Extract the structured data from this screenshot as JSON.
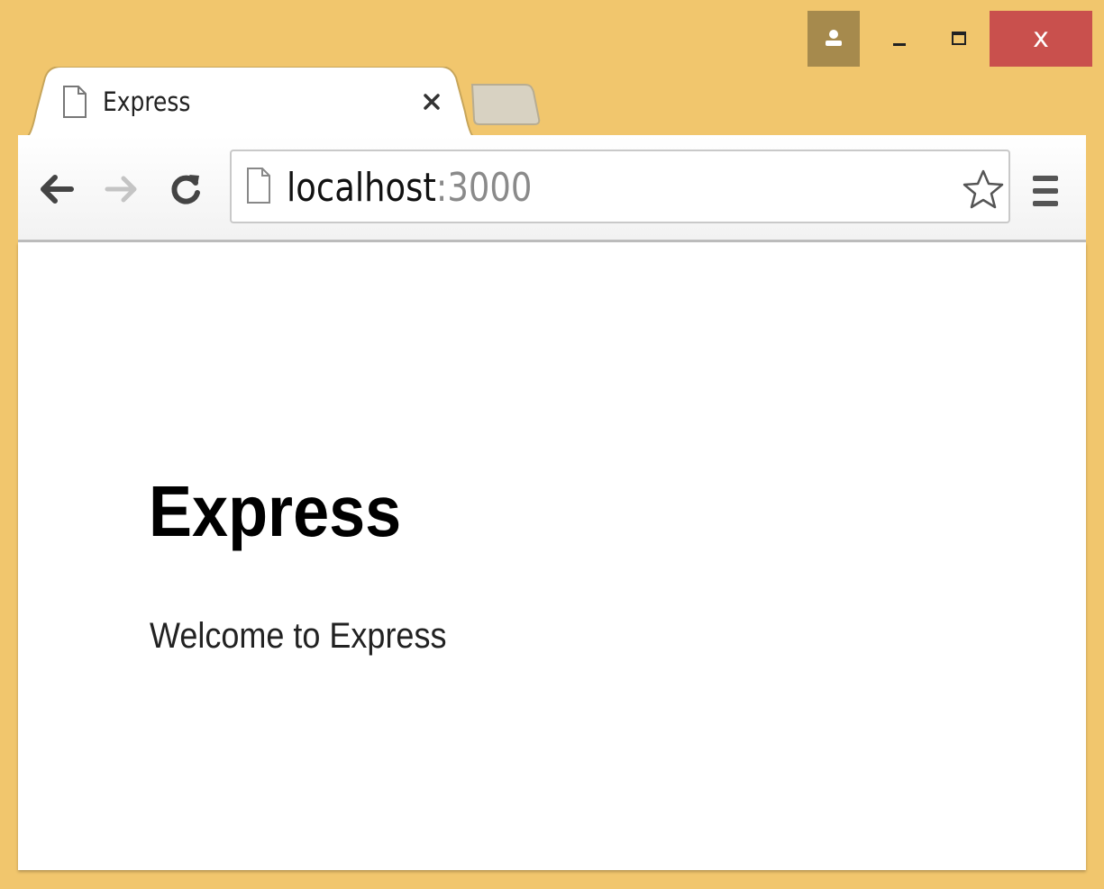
{
  "browser": {
    "tab": {
      "title": "Express"
    },
    "address_bar": {
      "host": "localhost",
      "port": ":3000"
    },
    "window_controls": {
      "close_label": "x"
    },
    "icons": {
      "profile": "person-icon",
      "minimize": "minimize-icon",
      "maximize": "maximize-icon",
      "close": "close-icon",
      "tab_page": "page-icon",
      "tab_close": "x-icon",
      "back": "arrow-left-icon",
      "forward": "arrow-right-icon",
      "reload": "reload-icon",
      "bookmark": "star-icon",
      "menu": "hamburger-icon"
    },
    "colors": {
      "frame": "#f1c66d",
      "close_button": "#c9504d",
      "profile_button": "#a68a4d"
    }
  },
  "page": {
    "heading": "Express",
    "text": "Welcome to Express"
  }
}
